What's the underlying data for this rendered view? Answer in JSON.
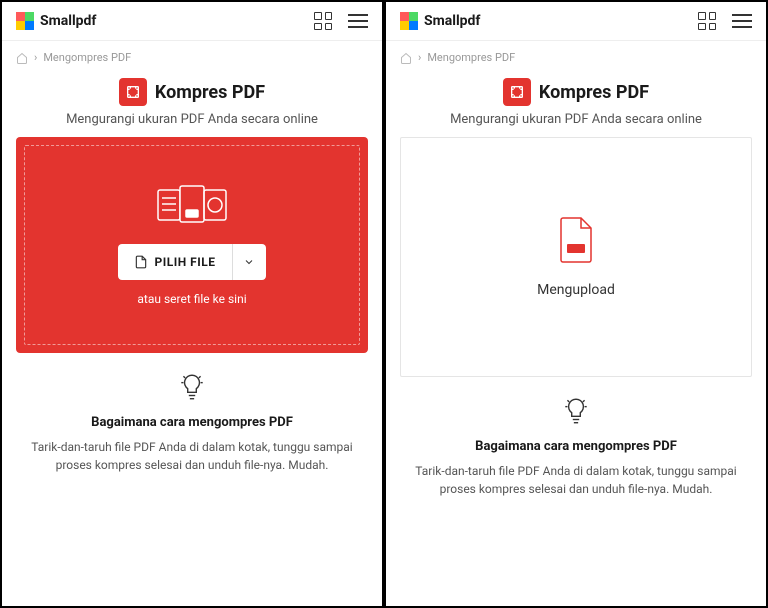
{
  "brand": "Smallpdf",
  "breadcrumb": {
    "item": "Mengompres PDF"
  },
  "title": "Kompres PDF",
  "subtitle": "Mengurangi ukuran PDF Anda secara online",
  "left": {
    "choose_label": "PILIH FILE",
    "hint": "atau seret file ke sini"
  },
  "right": {
    "upload_label": "Mengupload"
  },
  "howto": {
    "title": "Bagaimana cara mengompres PDF",
    "text": "Tarik-dan-taruh file PDF Anda di dalam kotak, tunggu sampai proses kompres selesai dan unduh file-nya. Mudah."
  },
  "colors": {
    "accent": "#e3342f"
  }
}
